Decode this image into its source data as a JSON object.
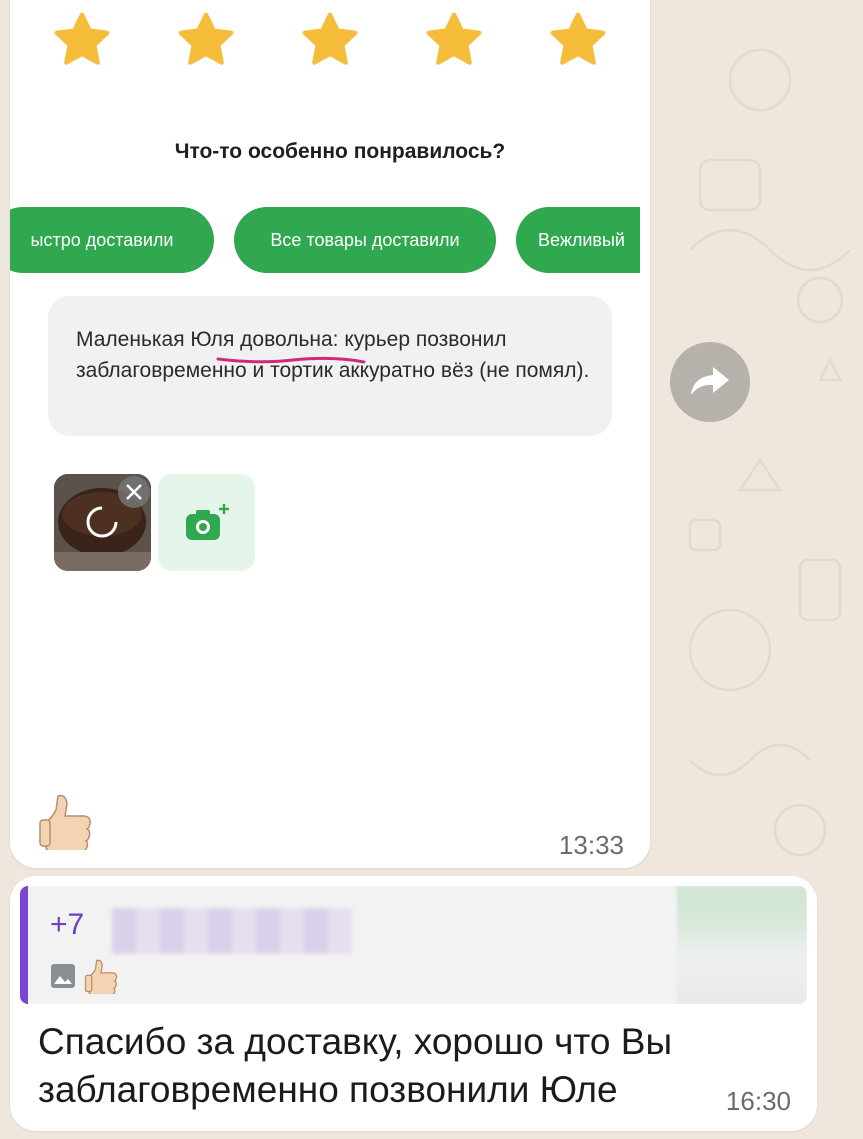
{
  "rating": {
    "stars": 5,
    "max": 5,
    "color": "#f6bd3a"
  },
  "screenshot": {
    "question": "Что-то особенно понравилось?",
    "chips": [
      {
        "label": "ыстро доставили"
      },
      {
        "label": "Все товары доставили"
      },
      {
        "label": "Вежливый"
      }
    ],
    "comment": "Маленькая Юля довольна: курьер позвонил заблаговременно и тортик аккуратно вёз (не помял).",
    "accent_color": "#2fa84f"
  },
  "message_1": {
    "reaction": "thumbs-up",
    "time": "13:33"
  },
  "message_2": {
    "quote": {
      "sender": "+7",
      "sender_color": "#6e3fc2"
    },
    "text": "Спасибо за доставку, хорошо что Вы заблаговременно позвонили Юле",
    "time": "16:30"
  }
}
